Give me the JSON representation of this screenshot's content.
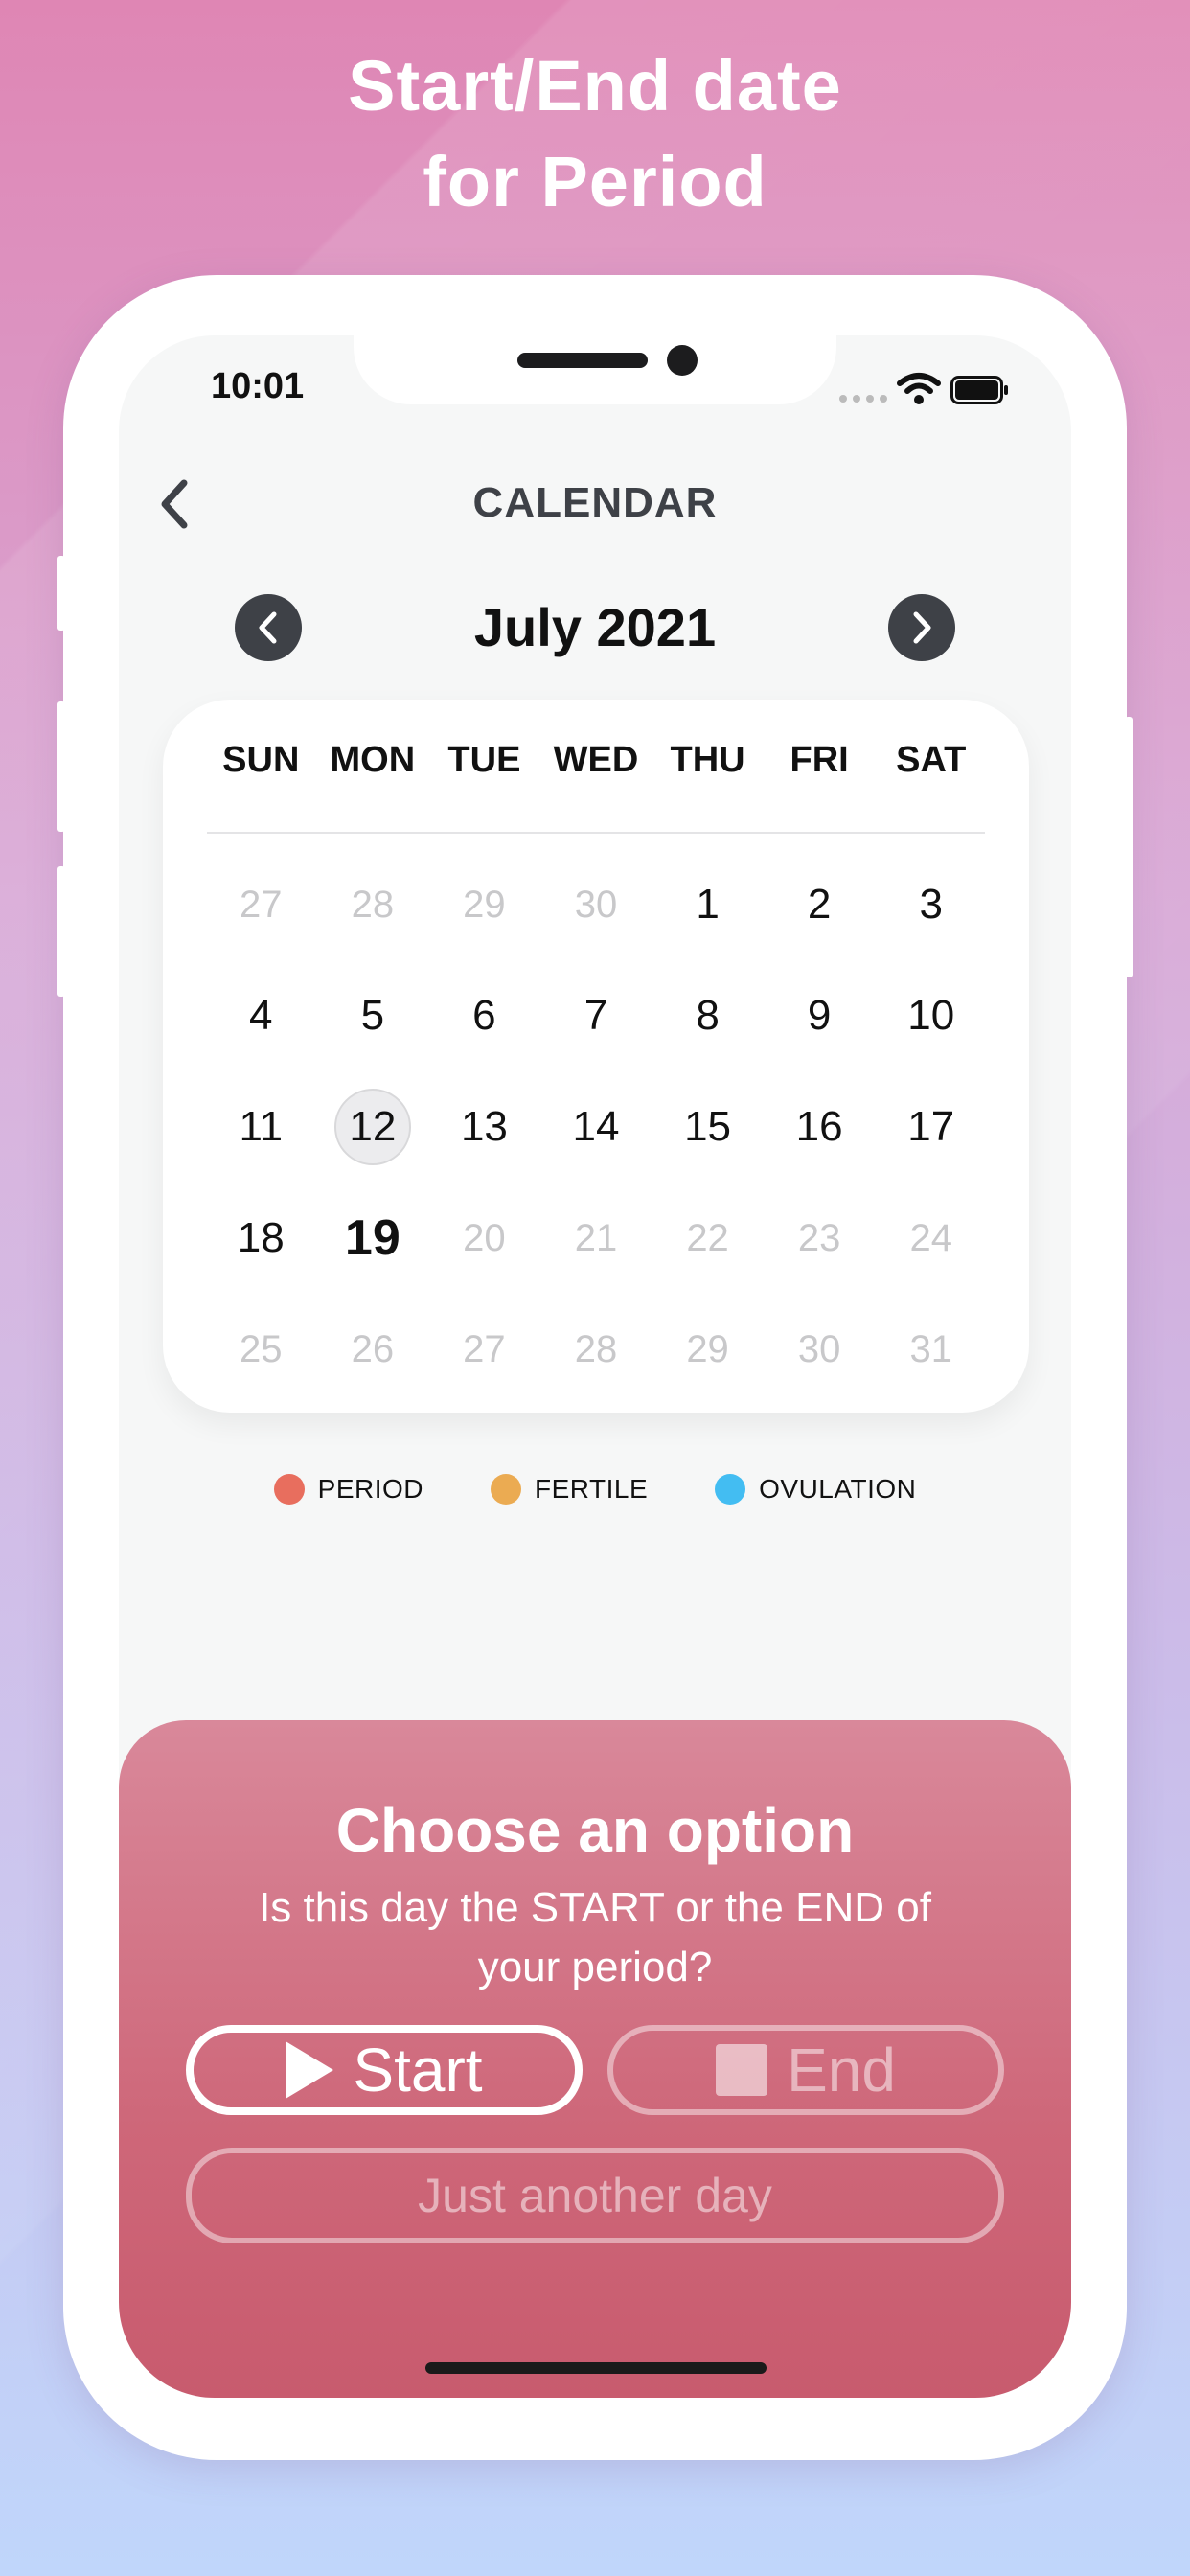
{
  "headline": {
    "line1": "Start/End date",
    "line2": "for Period"
  },
  "status_bar": {
    "time": "10:01"
  },
  "nav": {
    "title": "CALENDAR"
  },
  "calendar": {
    "month_label": "July 2021",
    "weekdays": [
      "SUN",
      "MON",
      "TUE",
      "WED",
      "THU",
      "FRI",
      "SAT"
    ],
    "days": [
      {
        "label": "27",
        "state": "muted"
      },
      {
        "label": "28",
        "state": "muted"
      },
      {
        "label": "29",
        "state": "muted"
      },
      {
        "label": "30",
        "state": "muted"
      },
      {
        "label": "1",
        "state": "normal"
      },
      {
        "label": "2",
        "state": "normal"
      },
      {
        "label": "3",
        "state": "normal"
      },
      {
        "label": "4",
        "state": "normal"
      },
      {
        "label": "5",
        "state": "normal"
      },
      {
        "label": "6",
        "state": "normal"
      },
      {
        "label": "7",
        "state": "normal"
      },
      {
        "label": "8",
        "state": "normal"
      },
      {
        "label": "9",
        "state": "normal"
      },
      {
        "label": "10",
        "state": "normal"
      },
      {
        "label": "11",
        "state": "normal"
      },
      {
        "label": "12",
        "state": "selected"
      },
      {
        "label": "13",
        "state": "normal"
      },
      {
        "label": "14",
        "state": "normal"
      },
      {
        "label": "15",
        "state": "normal"
      },
      {
        "label": "16",
        "state": "normal"
      },
      {
        "label": "17",
        "state": "normal"
      },
      {
        "label": "18",
        "state": "normal"
      },
      {
        "label": "19",
        "state": "today"
      },
      {
        "label": "20",
        "state": "muted"
      },
      {
        "label": "21",
        "state": "muted"
      },
      {
        "label": "22",
        "state": "muted"
      },
      {
        "label": "23",
        "state": "muted"
      },
      {
        "label": "24",
        "state": "muted"
      },
      {
        "label": "25",
        "state": "muted"
      },
      {
        "label": "26",
        "state": "muted"
      },
      {
        "label": "27",
        "state": "muted"
      },
      {
        "label": "28",
        "state": "muted"
      },
      {
        "label": "29",
        "state": "muted"
      },
      {
        "label": "30",
        "state": "muted"
      },
      {
        "label": "31",
        "state": "muted"
      }
    ]
  },
  "legend": [
    {
      "label": "PERIOD",
      "color": "#e86e5e"
    },
    {
      "label": "FERTILE",
      "color": "#ebab52"
    },
    {
      "label": "OVULATION",
      "color": "#43bdf2"
    }
  ],
  "sheet": {
    "title": "Choose an option",
    "subtitle": "Is this day the START or the END of your period?",
    "start_label": "Start",
    "end_label": "End",
    "other_label": "Just another day"
  },
  "colors": {
    "accent_dark": "#3e4147",
    "sheet_top": "#d9889a",
    "sheet_bottom": "#c85b6e"
  }
}
